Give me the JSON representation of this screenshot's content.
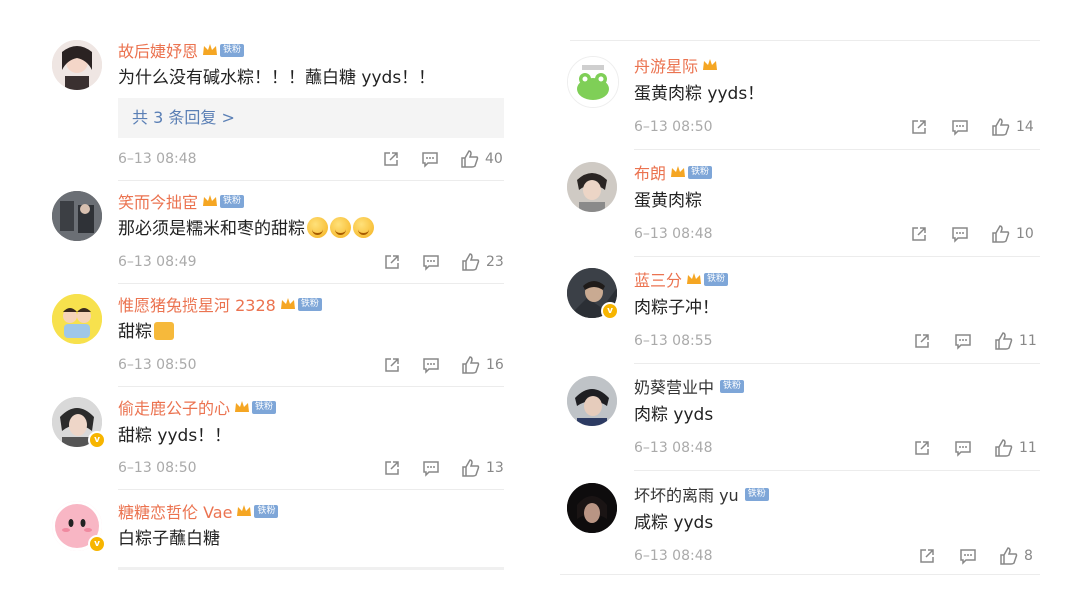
{
  "left": [
    {
      "name": "故后婕妤恩",
      "text": "为什么没有碱水粽！！！蘸白糖 yyds！！",
      "time": "6–13 08:48",
      "likes": "40",
      "replies_label": "共 3 条回复 >",
      "fan": "铁粉",
      "verified": false,
      "emojis": 0
    },
    {
      "name": "笑而今拙宦",
      "text": "那必须是糯米和枣的甜粽",
      "time": "6–13 08:49",
      "likes": "23",
      "fan": "铁粉",
      "verified": false,
      "emojis": 3
    },
    {
      "name": "惟愿猪兔揽星河 2328",
      "text": "甜粽",
      "time": "6–13 08:50",
      "likes": "16",
      "fan": "铁粉",
      "verified": false,
      "emojis": 0,
      "box_emoji": true
    },
    {
      "name": "偷走鹿公子的心",
      "text": "甜粽 yyds！！",
      "time": "6–13 08:50",
      "likes": "13",
      "fan": "铁粉",
      "verified": true,
      "emojis": 0
    },
    {
      "name": "糖糖恋哲伦 Vae",
      "text": "白粽子蘸白糖",
      "fan": "铁粉",
      "verified": true,
      "emojis": 0
    }
  ],
  "right": [
    {
      "name": "舟游星际",
      "text": "蛋黄肉粽 yyds！",
      "time": "6–13 08:50",
      "likes": "14",
      "fan": "",
      "verified": false
    },
    {
      "name": "布朗",
      "text": "蛋黄肉粽",
      "time": "6–13 08:48",
      "likes": "10",
      "fan": "铁粉",
      "verified": false
    },
    {
      "name": "蓝三分",
      "text": "肉粽子冲！",
      "time": "6–13 08:55",
      "likes": "11",
      "fan": "铁粉",
      "verified": true
    },
    {
      "name": "奶葵营业中",
      "text": "肉粽 yyds",
      "time": "6–13 08:48",
      "likes": "11",
      "fan": "铁粉",
      "verified": false
    },
    {
      "name": "坏坏的离雨 yu",
      "text": "咸粽 yyds",
      "time": "6–13 08:48",
      "likes": "8",
      "fan": "铁粉",
      "verified": false
    }
  ],
  "icons": {
    "share": "share-icon",
    "comment": "comment-icon",
    "like": "thumbs-up-icon",
    "crown": "crown-badge-icon",
    "verified": "verified-icon"
  },
  "colors": {
    "username": "#eb7350",
    "reply_link": "#5a7fb5",
    "fan_badge": "#7ea6d8",
    "meta": "#aaaaaa"
  }
}
